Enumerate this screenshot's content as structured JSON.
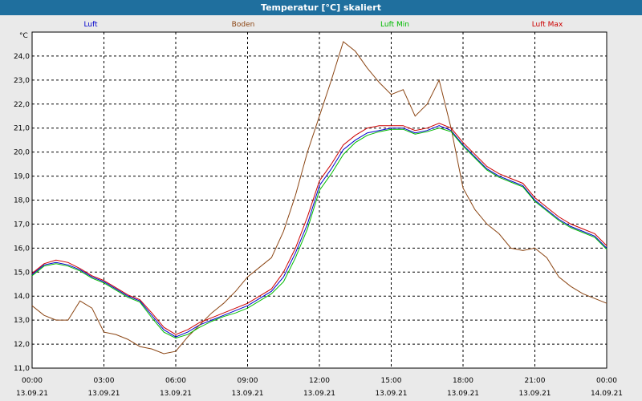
{
  "window": {
    "title": "Temperatur [°C] skaliert"
  },
  "chart_data": {
    "type": "line",
    "title": "Temperatur [°C] skaliert",
    "ylabel": "°C",
    "ylim": [
      11.0,
      25.0
    ],
    "yticks": [
      "11,0",
      "12,0",
      "13,0",
      "14,0",
      "15,0",
      "16,0",
      "17,0",
      "18,0",
      "19,0",
      "20,0",
      "21,0",
      "22,0",
      "23,0",
      "24,0"
    ],
    "xlim": [
      0,
      24
    ],
    "xticks": [
      {
        "time": "00:00",
        "date": "13.09.21"
      },
      {
        "time": "03:00",
        "date": "13.09.21"
      },
      {
        "time": "06:00",
        "date": "13.09.21"
      },
      {
        "time": "09:00",
        "date": "13.09.21"
      },
      {
        "time": "12:00",
        "date": "13.09.21"
      },
      {
        "time": "15:00",
        "date": "13.09.21"
      },
      {
        "time": "18:00",
        "date": "13.09.21"
      },
      {
        "time": "21:00",
        "date": "13.09.21"
      },
      {
        "time": "00:00",
        "date": "14.09.21"
      }
    ],
    "grid": true,
    "legend_position": "top",
    "series": [
      {
        "name": "Luft",
        "color": "#0000cc",
        "x": [
          0,
          0.5,
          1,
          1.5,
          2,
          2.5,
          3,
          3.5,
          4,
          4.5,
          5,
          5.5,
          6,
          6.5,
          7,
          7.5,
          8,
          8.5,
          9,
          9.5,
          10,
          10.5,
          11,
          11.5,
          12,
          12.5,
          13,
          13.5,
          14,
          14.5,
          15,
          15.5,
          16,
          16.5,
          17,
          17.5,
          18,
          18.5,
          19,
          19.5,
          20,
          20.5,
          21,
          21.5,
          22,
          22.5,
          23,
          23.5,
          24
        ],
        "values": [
          14.9,
          15.3,
          15.4,
          15.3,
          15.1,
          14.8,
          14.6,
          14.3,
          14.0,
          13.8,
          13.2,
          12.6,
          12.3,
          12.5,
          12.8,
          13.0,
          13.2,
          13.4,
          13.6,
          13.9,
          14.2,
          14.8,
          15.8,
          17.0,
          18.6,
          19.3,
          20.1,
          20.5,
          20.8,
          20.9,
          21.0,
          21.0,
          20.8,
          20.9,
          21.1,
          20.9,
          20.3,
          19.8,
          19.3,
          19.0,
          18.8,
          18.6,
          18.0,
          17.6,
          17.2,
          16.9,
          16.7,
          16.5,
          16.0
        ]
      },
      {
        "name": "Boden",
        "color": "#8b4513",
        "x": [
          0,
          0.5,
          1,
          1.5,
          2,
          2.5,
          3,
          3.5,
          4,
          4.5,
          5,
          5.5,
          6,
          6.5,
          7,
          7.5,
          8,
          8.5,
          9,
          9.5,
          10,
          10.5,
          11,
          11.5,
          12,
          12.5,
          13,
          13.5,
          14,
          14.5,
          15,
          15.5,
          16,
          16.5,
          17,
          17.5,
          18,
          18.5,
          19,
          19.5,
          20,
          20.5,
          21,
          21.5,
          22,
          22.5,
          23,
          23.5,
          24
        ],
        "values": [
          13.6,
          13.2,
          13.0,
          13.0,
          13.8,
          13.5,
          12.5,
          12.4,
          12.2,
          11.9,
          11.8,
          11.6,
          11.7,
          12.3,
          12.8,
          13.3,
          13.7,
          14.2,
          14.8,
          15.2,
          15.6,
          16.7,
          18.2,
          20.0,
          21.5,
          23.0,
          24.6,
          24.2,
          23.5,
          22.9,
          22.4,
          22.6,
          21.5,
          22.0,
          23.0,
          21.0,
          18.5,
          17.6,
          17.0,
          16.6,
          16.0,
          15.9,
          16.0,
          15.6,
          14.8,
          14.4,
          14.1,
          13.9,
          13.7
        ]
      },
      {
        "name": "Luft Min",
        "color": "#00bb00",
        "x": [
          0,
          0.5,
          1,
          1.5,
          2,
          2.5,
          3,
          3.5,
          4,
          4.5,
          5,
          5.5,
          6,
          6.5,
          7,
          7.5,
          8,
          8.5,
          9,
          9.5,
          10,
          10.5,
          11,
          11.5,
          12,
          12.5,
          13,
          13.5,
          14,
          14.5,
          15,
          15.5,
          16,
          16.5,
          17,
          17.5,
          18,
          18.5,
          19,
          19.5,
          20,
          20.5,
          21,
          21.5,
          22,
          22.5,
          23,
          23.5,
          24
        ],
        "values": [
          14.85,
          15.25,
          15.35,
          15.25,
          15.05,
          14.75,
          14.55,
          14.25,
          13.95,
          13.75,
          13.1,
          12.5,
          12.25,
          12.4,
          12.7,
          12.95,
          13.15,
          13.3,
          13.5,
          13.8,
          14.1,
          14.6,
          15.6,
          16.8,
          18.4,
          19.1,
          19.9,
          20.4,
          20.7,
          20.85,
          20.95,
          20.95,
          20.75,
          20.85,
          21.0,
          20.85,
          20.25,
          19.75,
          19.25,
          18.95,
          18.75,
          18.55,
          17.95,
          17.55,
          17.15,
          16.85,
          16.65,
          16.45,
          15.95
        ]
      },
      {
        "name": "Luft Max",
        "color": "#cc0000",
        "x": [
          0,
          0.5,
          1,
          1.5,
          2,
          2.5,
          3,
          3.5,
          4,
          4.5,
          5,
          5.5,
          6,
          6.5,
          7,
          7.5,
          8,
          8.5,
          9,
          9.5,
          10,
          10.5,
          11,
          11.5,
          12,
          12.5,
          13,
          13.5,
          14,
          14.5,
          15,
          15.5,
          16,
          16.5,
          17,
          17.5,
          18,
          18.5,
          19,
          19.5,
          20,
          20.5,
          21,
          21.5,
          22,
          22.5,
          23,
          23.5,
          24
        ],
        "values": [
          14.95,
          15.35,
          15.5,
          15.4,
          15.15,
          14.85,
          14.65,
          14.35,
          14.05,
          13.85,
          13.3,
          12.7,
          12.4,
          12.6,
          12.9,
          13.1,
          13.3,
          13.5,
          13.7,
          14.0,
          14.3,
          15.0,
          16.0,
          17.3,
          18.8,
          19.5,
          20.3,
          20.7,
          21.0,
          21.1,
          21.1,
          21.1,
          20.9,
          21.0,
          21.2,
          21.0,
          20.4,
          19.9,
          19.4,
          19.1,
          18.9,
          18.7,
          18.1,
          17.7,
          17.3,
          17.0,
          16.8,
          16.6,
          16.1
        ]
      }
    ]
  }
}
